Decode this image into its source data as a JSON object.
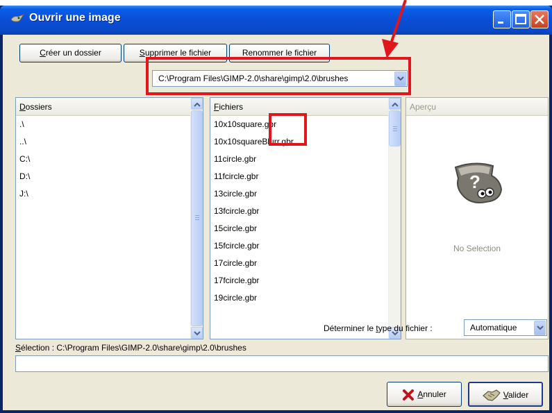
{
  "window": {
    "title": "Ouvrir une image"
  },
  "toolbar": {
    "create_folder_label": "Créer un dossier",
    "create_folder_mnemonic": "C",
    "create_folder_rest": "réer un dossier",
    "delete_file_label": "Supprimer le fichier",
    "delete_file_mnemonic": "S",
    "delete_file_rest": "upprimer le fichier",
    "rename_file_label": "Renommer le fichier"
  },
  "location": {
    "path": "C:\\Program Files\\GIMP-2.0\\share\\gimp\\2.0\\brushes"
  },
  "folders": {
    "header_mnemonic": "D",
    "header_rest": "ossiers",
    "items": [
      ".\\",
      "..\\",
      "C:\\",
      "D:\\",
      "J:\\"
    ]
  },
  "files": {
    "header_mnemonic": "F",
    "header_rest": "ichiers",
    "items": [
      "10x10square.gbr",
      "10x10squareBlurr.gbr",
      "11circle.gbr",
      "11fcircle.gbr",
      "13circle.gbr",
      "13fcircle.gbr",
      "15circle.gbr",
      "15fcircle.gbr",
      "17circle.gbr",
      "17fcircle.gbr",
      "19circle.gbr"
    ]
  },
  "preview": {
    "header": "Aperçu",
    "empty_text": "No Selection"
  },
  "file_type": {
    "label_before": "Déterminer le ",
    "label_mnemonic": "t",
    "label_after": "ype du fichier :",
    "value": "Automatique"
  },
  "selection": {
    "label_mnemonic": "S",
    "label_rest": "élection : C:\\Program Files\\GIMP-2.0\\share\\gimp\\2.0\\brushes",
    "input_value": ""
  },
  "buttons": {
    "cancel_mnemonic": "A",
    "cancel_rest": "nnuler",
    "ok_mnemonic": "V",
    "ok_rest": "alider"
  },
  "colors": {
    "titlebar": "#0a4fd8",
    "dialog_bg": "#ece9d8",
    "annotation": "#e0161c"
  },
  "icons": {
    "title": "gimp-wilber-icon",
    "preview": "gimp-question-icon",
    "cancel": "red-x-icon",
    "ok": "handshake-icon"
  }
}
